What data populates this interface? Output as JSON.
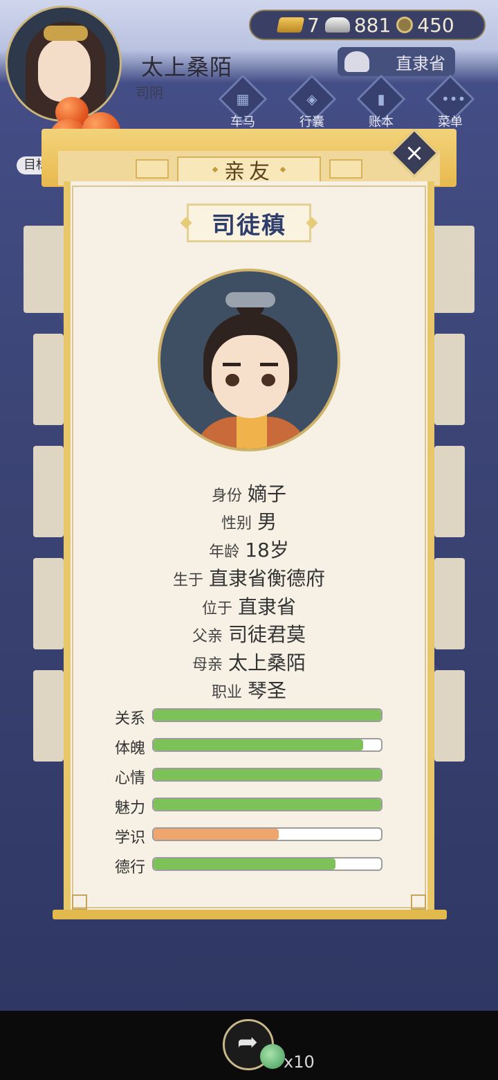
{
  "header": {
    "player_name": "太上桑陌",
    "player_title": "司阴",
    "currency": {
      "gold": "7",
      "silver": "881",
      "coins": "450"
    },
    "location": "直隶省",
    "menu": [
      {
        "label": "车马",
        "icon": "carriage-icon"
      },
      {
        "label": "行囊",
        "icon": "bag-icon"
      },
      {
        "label": "账本",
        "icon": "ledger-icon"
      },
      {
        "label": "菜单",
        "icon": "more-icon"
      }
    ],
    "goal_label": "目标"
  },
  "dialog": {
    "title": "亲友",
    "character_name": "司徒稹",
    "info": [
      {
        "key": "身份",
        "value": "嫡子"
      },
      {
        "key": "性别",
        "value": "男"
      },
      {
        "key": "年龄",
        "value": "18岁"
      },
      {
        "key": "生于",
        "value": "直隶省衡德府"
      },
      {
        "key": "位于",
        "value": "直隶省"
      },
      {
        "key": "父亲",
        "value": "司徒君莫"
      },
      {
        "key": "母亲",
        "value": "太上桑陌"
      },
      {
        "key": "职业",
        "value": "琴圣"
      }
    ],
    "stats": [
      {
        "label": "关系",
        "level": 1.0,
        "color": "#7cc258"
      },
      {
        "label": "体魄",
        "level": 0.92,
        "color": "#7cc258"
      },
      {
        "label": "心情",
        "level": 1.0,
        "color": "#7cc258"
      },
      {
        "label": "魅力",
        "level": 1.0,
        "color": "#7cc258"
      },
      {
        "label": "学识",
        "level": 0.55,
        "color": "#f0a56c"
      },
      {
        "label": "德行",
        "level": 0.8,
        "color": "#7cc258"
      }
    ]
  },
  "footer": {
    "share_count": "x10"
  }
}
